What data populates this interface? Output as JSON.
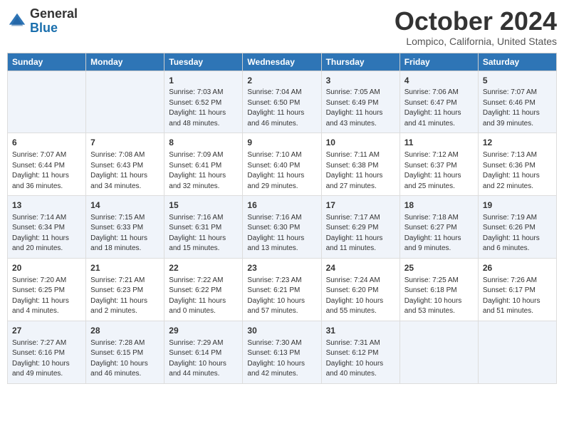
{
  "header": {
    "logo_line1": "General",
    "logo_line2": "Blue",
    "month": "October 2024",
    "location": "Lompico, California, United States"
  },
  "days_of_week": [
    "Sunday",
    "Monday",
    "Tuesday",
    "Wednesday",
    "Thursday",
    "Friday",
    "Saturday"
  ],
  "weeks": [
    [
      {
        "day": "",
        "info": ""
      },
      {
        "day": "",
        "info": ""
      },
      {
        "day": "1",
        "info": "Sunrise: 7:03 AM\nSunset: 6:52 PM\nDaylight: 11 hours and 48 minutes."
      },
      {
        "day": "2",
        "info": "Sunrise: 7:04 AM\nSunset: 6:50 PM\nDaylight: 11 hours and 46 minutes."
      },
      {
        "day": "3",
        "info": "Sunrise: 7:05 AM\nSunset: 6:49 PM\nDaylight: 11 hours and 43 minutes."
      },
      {
        "day": "4",
        "info": "Sunrise: 7:06 AM\nSunset: 6:47 PM\nDaylight: 11 hours and 41 minutes."
      },
      {
        "day": "5",
        "info": "Sunrise: 7:07 AM\nSunset: 6:46 PM\nDaylight: 11 hours and 39 minutes."
      }
    ],
    [
      {
        "day": "6",
        "info": "Sunrise: 7:07 AM\nSunset: 6:44 PM\nDaylight: 11 hours and 36 minutes."
      },
      {
        "day": "7",
        "info": "Sunrise: 7:08 AM\nSunset: 6:43 PM\nDaylight: 11 hours and 34 minutes."
      },
      {
        "day": "8",
        "info": "Sunrise: 7:09 AM\nSunset: 6:41 PM\nDaylight: 11 hours and 32 minutes."
      },
      {
        "day": "9",
        "info": "Sunrise: 7:10 AM\nSunset: 6:40 PM\nDaylight: 11 hours and 29 minutes."
      },
      {
        "day": "10",
        "info": "Sunrise: 7:11 AM\nSunset: 6:38 PM\nDaylight: 11 hours and 27 minutes."
      },
      {
        "day": "11",
        "info": "Sunrise: 7:12 AM\nSunset: 6:37 PM\nDaylight: 11 hours and 25 minutes."
      },
      {
        "day": "12",
        "info": "Sunrise: 7:13 AM\nSunset: 6:36 PM\nDaylight: 11 hours and 22 minutes."
      }
    ],
    [
      {
        "day": "13",
        "info": "Sunrise: 7:14 AM\nSunset: 6:34 PM\nDaylight: 11 hours and 20 minutes."
      },
      {
        "day": "14",
        "info": "Sunrise: 7:15 AM\nSunset: 6:33 PM\nDaylight: 11 hours and 18 minutes."
      },
      {
        "day": "15",
        "info": "Sunrise: 7:16 AM\nSunset: 6:31 PM\nDaylight: 11 hours and 15 minutes."
      },
      {
        "day": "16",
        "info": "Sunrise: 7:16 AM\nSunset: 6:30 PM\nDaylight: 11 hours and 13 minutes."
      },
      {
        "day": "17",
        "info": "Sunrise: 7:17 AM\nSunset: 6:29 PM\nDaylight: 11 hours and 11 minutes."
      },
      {
        "day": "18",
        "info": "Sunrise: 7:18 AM\nSunset: 6:27 PM\nDaylight: 11 hours and 9 minutes."
      },
      {
        "day": "19",
        "info": "Sunrise: 7:19 AM\nSunset: 6:26 PM\nDaylight: 11 hours and 6 minutes."
      }
    ],
    [
      {
        "day": "20",
        "info": "Sunrise: 7:20 AM\nSunset: 6:25 PM\nDaylight: 11 hours and 4 minutes."
      },
      {
        "day": "21",
        "info": "Sunrise: 7:21 AM\nSunset: 6:23 PM\nDaylight: 11 hours and 2 minutes."
      },
      {
        "day": "22",
        "info": "Sunrise: 7:22 AM\nSunset: 6:22 PM\nDaylight: 11 hours and 0 minutes."
      },
      {
        "day": "23",
        "info": "Sunrise: 7:23 AM\nSunset: 6:21 PM\nDaylight: 10 hours and 57 minutes."
      },
      {
        "day": "24",
        "info": "Sunrise: 7:24 AM\nSunset: 6:20 PM\nDaylight: 10 hours and 55 minutes."
      },
      {
        "day": "25",
        "info": "Sunrise: 7:25 AM\nSunset: 6:18 PM\nDaylight: 10 hours and 53 minutes."
      },
      {
        "day": "26",
        "info": "Sunrise: 7:26 AM\nSunset: 6:17 PM\nDaylight: 10 hours and 51 minutes."
      }
    ],
    [
      {
        "day": "27",
        "info": "Sunrise: 7:27 AM\nSunset: 6:16 PM\nDaylight: 10 hours and 49 minutes."
      },
      {
        "day": "28",
        "info": "Sunrise: 7:28 AM\nSunset: 6:15 PM\nDaylight: 10 hours and 46 minutes."
      },
      {
        "day": "29",
        "info": "Sunrise: 7:29 AM\nSunset: 6:14 PM\nDaylight: 10 hours and 44 minutes."
      },
      {
        "day": "30",
        "info": "Sunrise: 7:30 AM\nSunset: 6:13 PM\nDaylight: 10 hours and 42 minutes."
      },
      {
        "day": "31",
        "info": "Sunrise: 7:31 AM\nSunset: 6:12 PM\nDaylight: 10 hours and 40 minutes."
      },
      {
        "day": "",
        "info": ""
      },
      {
        "day": "",
        "info": ""
      }
    ]
  ]
}
